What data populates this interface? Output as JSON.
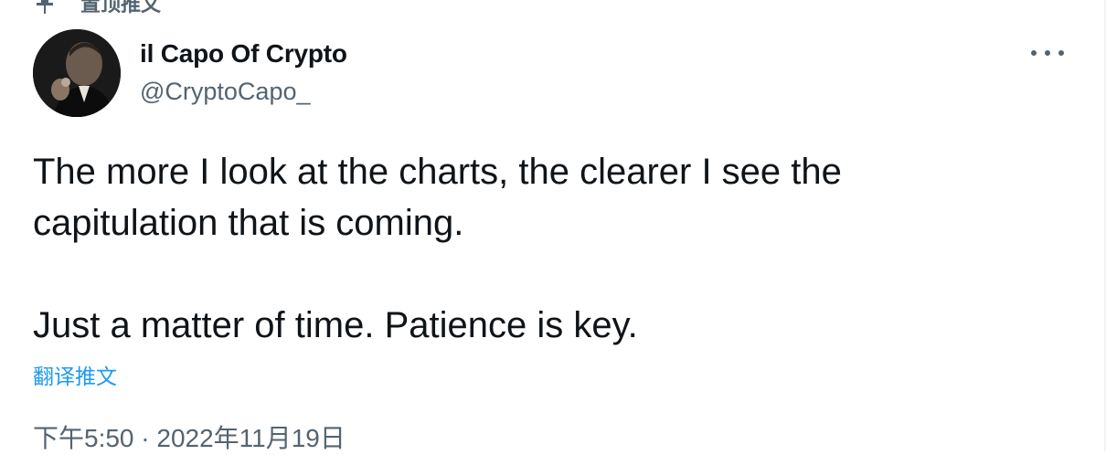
{
  "pinned": {
    "label": "置顶推文",
    "icon": "pin-icon"
  },
  "author": {
    "display_name": "il Capo Of Crypto",
    "handle": "@CryptoCapo_",
    "avatar_icon": "avatar"
  },
  "more_icon": "more-icon",
  "tweet": {
    "line1": "The more I look at the charts, the clearer I see the",
    "line2": "capitulation that is coming.",
    "line3": "Just a matter of time. Patience is key."
  },
  "translate_label": "翻译推文",
  "timestamp": "下午5:50 · 2022年11月19日",
  "colors": {
    "text": "#0f1419",
    "secondary": "#536471",
    "link": "#1d9bf0"
  }
}
